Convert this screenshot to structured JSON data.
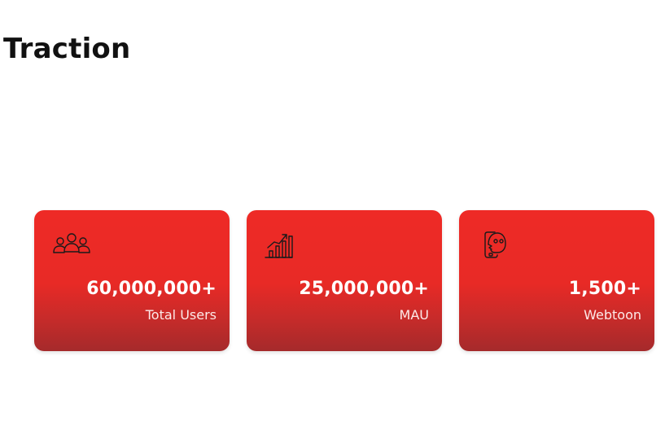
{
  "page": {
    "title": "Traction"
  },
  "stats": [
    {
      "icon": "users-group-icon",
      "value": "60,000,000+",
      "label": "Total Users"
    },
    {
      "icon": "growth-chart-icon",
      "value": "25,000,000+",
      "label": "MAU"
    },
    {
      "icon": "webtoon-ghost-icon",
      "value": "1,500+",
      "label": "Webtoon"
    }
  ],
  "colors": {
    "card_top": "#ee2a26",
    "card_bottom": "#a52a2b",
    "title_text": "#111111",
    "card_text": "#ffffff"
  }
}
